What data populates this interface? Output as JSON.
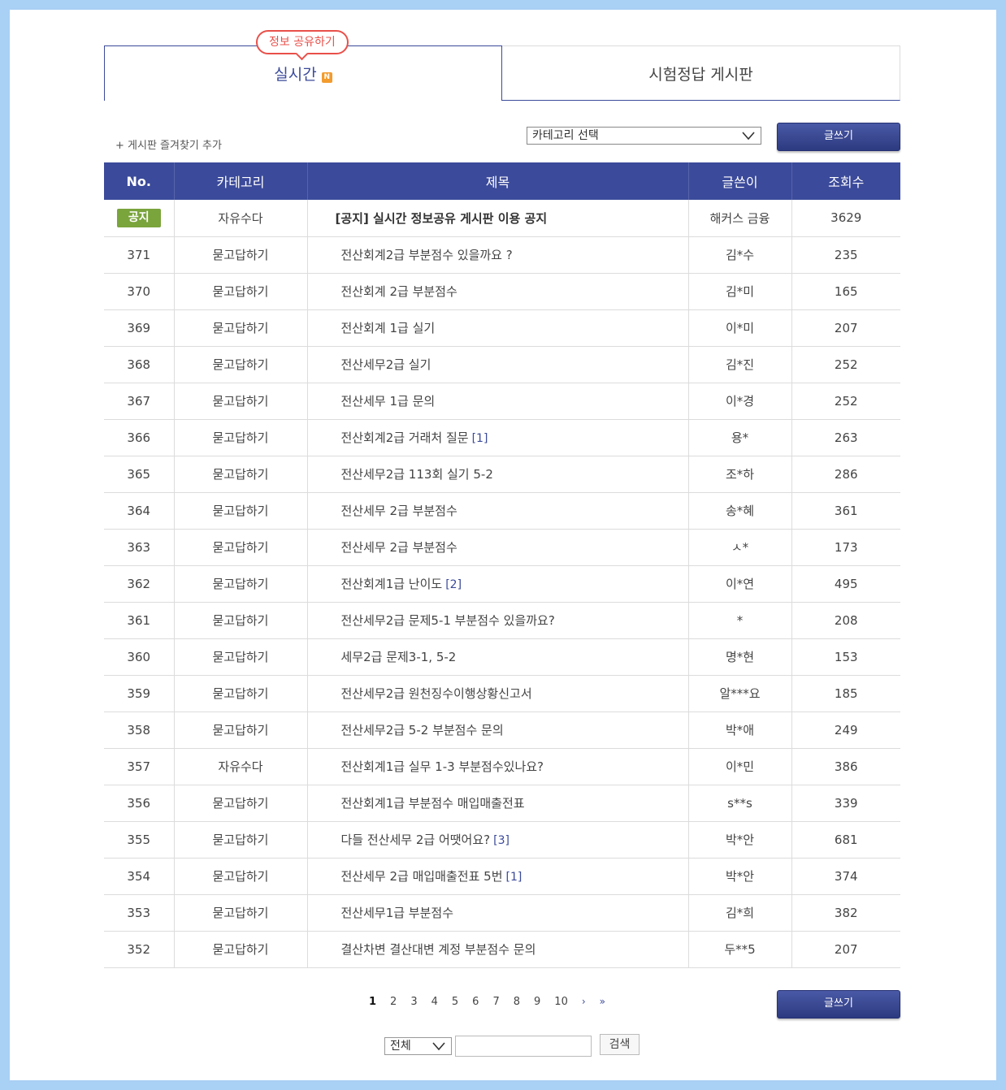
{
  "tabs": {
    "bubble_label": "정보 공유하기",
    "active_label": "실시간",
    "new_badge": "N",
    "inactive_label": "시험정답 게시판"
  },
  "toolbar": {
    "favorite_link": "+ 게시판 즐겨찾기 추가",
    "category_select_value": "카테고리 선택",
    "write_label": "글쓰기"
  },
  "table": {
    "headers": [
      "No.",
      "카테고리",
      "제목",
      "글쓴이",
      "조회수"
    ],
    "notice": {
      "tag": "공지",
      "category": "자유수다",
      "title": "[공지] 실시간 정보공유 게시판 이용 공지",
      "author": "해커스 금융",
      "views": "3629"
    },
    "rows": [
      {
        "no": "371",
        "category": "묻고답하기",
        "title": "전산회계2급 부분점수 있을까요 ?",
        "replies": "",
        "author": "김*수",
        "views": "235"
      },
      {
        "no": "370",
        "category": "묻고답하기",
        "title": "전산회계 2급 부분점수",
        "replies": "",
        "author": "김*미",
        "views": "165"
      },
      {
        "no": "369",
        "category": "묻고답하기",
        "title": "전산회계 1급 실기",
        "replies": "",
        "author": "이*미",
        "views": "207"
      },
      {
        "no": "368",
        "category": "묻고답하기",
        "title": "전산세무2급 실기",
        "replies": "",
        "author": "김*진",
        "views": "252"
      },
      {
        "no": "367",
        "category": "묻고답하기",
        "title": "전산세무 1급 문의",
        "replies": "",
        "author": "이*경",
        "views": "252"
      },
      {
        "no": "366",
        "category": "묻고답하기",
        "title": "전산회계2급 거래처 질문",
        "replies": "[1]",
        "author": "용*",
        "views": "263"
      },
      {
        "no": "365",
        "category": "묻고답하기",
        "title": "전산세무2급 113회 실기 5-2",
        "replies": "",
        "author": "조*하",
        "views": "286"
      },
      {
        "no": "364",
        "category": "묻고답하기",
        "title": "전산세무 2급 부분점수",
        "replies": "",
        "author": "송*혜",
        "views": "361"
      },
      {
        "no": "363",
        "category": "묻고답하기",
        "title": "전산세무 2급 부분점수",
        "replies": "",
        "author": "ㅅ*",
        "views": "173"
      },
      {
        "no": "362",
        "category": "묻고답하기",
        "title": "전산회계1급 난이도",
        "replies": "[2]",
        "author": "이*연",
        "views": "495"
      },
      {
        "no": "361",
        "category": "묻고답하기",
        "title": "전산세무2급 문제5-1 부분점수 있을까요?",
        "replies": "",
        "author": "*",
        "views": "208"
      },
      {
        "no": "360",
        "category": "묻고답하기",
        "title": "세무2급 문제3-1, 5-2",
        "replies": "",
        "author": "명*현",
        "views": "153"
      },
      {
        "no": "359",
        "category": "묻고답하기",
        "title": "전산세무2급 원천징수이행상황신고서",
        "replies": "",
        "author": "알***요",
        "views": "185"
      },
      {
        "no": "358",
        "category": "묻고답하기",
        "title": "전산세무2급 5-2 부분점수 문의",
        "replies": "",
        "author": "박*애",
        "views": "249"
      },
      {
        "no": "357",
        "category": "자유수다",
        "title": "전산회계1급 실무 1-3 부분점수있나요?",
        "replies": "",
        "author": "이*민",
        "views": "386"
      },
      {
        "no": "356",
        "category": "묻고답하기",
        "title": "전산회계1급 부분점수 매입매출전표",
        "replies": "",
        "author": "s**s",
        "views": "339"
      },
      {
        "no": "355",
        "category": "묻고답하기",
        "title": "다들 전산세무 2급 어땟어요?",
        "replies": "[3]",
        "author": "박*안",
        "views": "681"
      },
      {
        "no": "354",
        "category": "묻고답하기",
        "title": "전산세무 2급 매입매출전표 5번",
        "replies": "[1]",
        "author": "박*안",
        "views": "374"
      },
      {
        "no": "353",
        "category": "묻고답하기",
        "title": "전산세무1급 부분점수",
        "replies": "",
        "author": "김*희",
        "views": "382"
      },
      {
        "no": "352",
        "category": "묻고답하기",
        "title": "결산차변 결산대변 계정 부분점수 문의",
        "replies": "",
        "author": "두**5",
        "views": "207"
      }
    ]
  },
  "pagination": {
    "pages": [
      "1",
      "2",
      "3",
      "4",
      "5",
      "6",
      "7",
      "8",
      "9",
      "10"
    ],
    "current": "1",
    "next": "›",
    "last": "»"
  },
  "search": {
    "scope_value": "전체",
    "input_value": "",
    "button_label": "검색"
  },
  "colors": {
    "accent": "#3b4a9a",
    "notice_tag": "#7aa43c",
    "bubble": "#e9504a",
    "new_badge": "#f29b2e",
    "page_background": "#a9d0f5"
  }
}
